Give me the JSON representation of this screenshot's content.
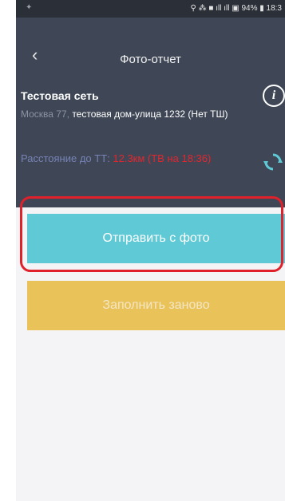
{
  "status_bar": {
    "icons_text": "⚲ ⁂ ■ ıll ıll ▣ 94% ▮ 18:3"
  },
  "header": {
    "back_icon": "chevron-left-icon",
    "title": "Фото-отчет"
  },
  "store": {
    "name": "Тестовая сеть",
    "city": "Москва 77,",
    "address": " тестовая дом-улица 1232 (Нет ТШ)"
  },
  "distance": {
    "label": "Расстояние до ТТ: ",
    "value": "12.3км (ТВ на 18:36)"
  },
  "buttons": {
    "send_with_photo": "Отправить с фото",
    "refill": "Заполнить заново"
  },
  "colors": {
    "header_bg": "#3f4756",
    "send_button": "#5fcad6",
    "refill_button": "#e9c35a",
    "highlight": "#e0202a",
    "distance_value": "#e3262e"
  }
}
